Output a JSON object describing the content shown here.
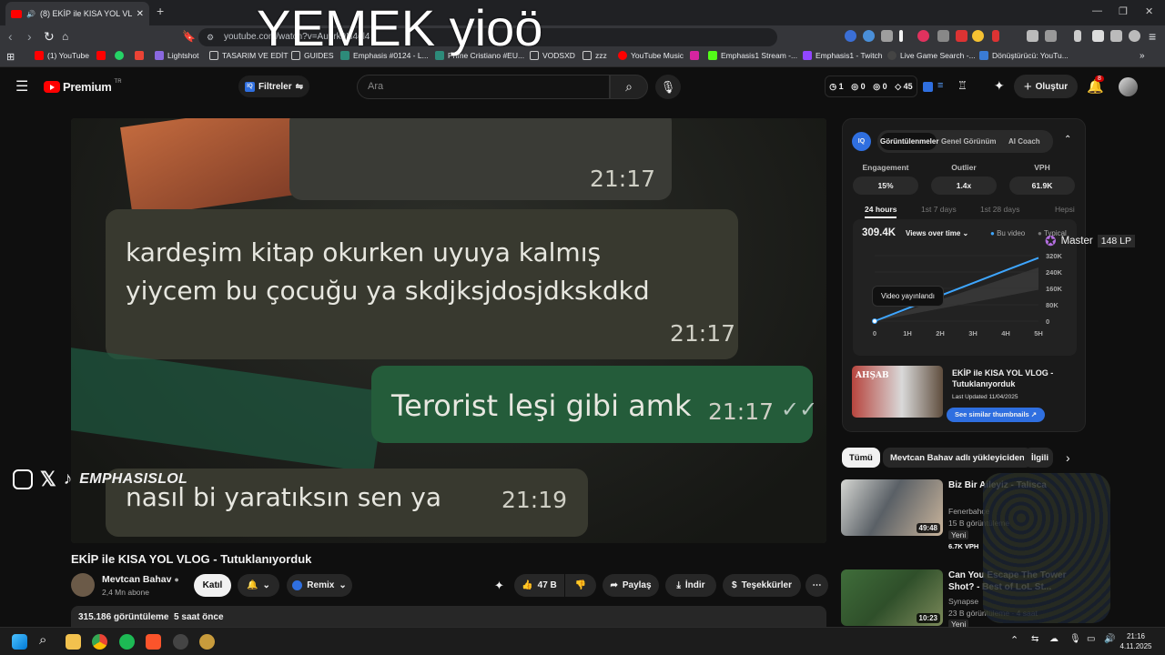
{
  "browser": {
    "tab_title": "(8) EKİP ile KISA YOL VLOG - T",
    "url": "youtube.com/watch?v=Au9rk0N4gl4",
    "bookmarks": [
      "(1) YouTube",
      "Lightshot",
      "TASARIM VE EDİT",
      "GUIDES",
      "Emphasis #0124 - L...",
      "Prime Cristiano #EU...",
      "VODSXD",
      "zzz",
      "YouTube Music",
      "Emphasis1 Stream -...",
      "Emphasis1 - Twitch",
      "Live Game Search -...",
      "Dönüştürücü: YouTu..."
    ]
  },
  "overlay": {
    "big_text": "YEMEK yioö"
  },
  "youtube": {
    "logo_text": "Premium",
    "logo_sup": "TR",
    "filter_label": "Filtreler",
    "search_placeholder": "Ara",
    "header_stats": [
      "1",
      "0",
      "0",
      "45"
    ],
    "create_label": "Oluştur",
    "notif_count": "8"
  },
  "video": {
    "messages": [
      {
        "text": "",
        "time": "21:17"
      },
      {
        "text_line1": "kardeşim kitap okurken uyuya kalmış",
        "text_line2": "yiycem bu çocuğu ya skdjksjdosjdkskdkd",
        "time": "21:17"
      },
      {
        "text": "Terorist leşi gibi amk",
        "time": "21:17"
      },
      {
        "text": "nasıl bi yaratıksın sen ya",
        "time": "21:19"
      }
    ],
    "watermark": "EMPHASISLOL"
  },
  "info": {
    "title": "EKİP ile KISA YOL VLOG - Tutuklanıyorduk",
    "channel": "Mevtcan Bahav",
    "subs": "2,4 Mn abone",
    "join": "Katıl",
    "remix": "Remix",
    "likes": "47 B",
    "share": "Paylaş",
    "download": "İndir",
    "thanks": "Teşekkürler",
    "views_line": "315.186 görüntüleme  5 saat önce"
  },
  "iq_panel": {
    "tabs": [
      "Görüntülenmeler",
      "Genel Görünüm",
      "AI Coach"
    ],
    "stat_labels": [
      "Engagement",
      "Outlier",
      "VPH"
    ],
    "stat_values": [
      "15%",
      "1.4x",
      "61.9K"
    ],
    "ranges": [
      "24 hours",
      "1st 7 days",
      "1st 28 days",
      "Hepsi"
    ],
    "views_total": "309.4K",
    "views_mode": "Views over time",
    "legend": [
      "Bu video",
      "Typical"
    ],
    "tooltip": "Video yayınlandı",
    "rank": "Master",
    "lp": "148 LP",
    "video_title": "EKİP ile KISA YOL VLOG - Tutuklanıyorduk",
    "updated": "Last Updated 11/04/2025",
    "similar_btn": "See similar thumbnails",
    "chart_data": {
      "type": "line",
      "x": [
        "0",
        "1H",
        "2H",
        "3H",
        "4H",
        "5H"
      ],
      "y_ticks": [
        "320K",
        "240K",
        "160K",
        "80K",
        "0"
      ],
      "ylim": [
        0,
        320000
      ],
      "series": [
        {
          "name": "Bu video",
          "values": [
            0,
            62000,
            124000,
            186000,
            248000,
            309400
          ]
        }
      ]
    }
  },
  "chips": [
    "Tümü",
    "Mevtcan Bahav adlı yükleyiciden",
    "İlgili"
  ],
  "recs": [
    {
      "title": "Biz Bir Aileyiz - Talisca",
      "channel": "Fenerbahçe",
      "meta": "15 B görüntüleme",
      "badge": "Yeni",
      "vph": "6.7K VPH",
      "duration": "49:48"
    },
    {
      "title": "Can You Escape The Tower Shot? - Best of LoL St...",
      "channel": "Synapse",
      "meta": "23 B görüntüleme · 4 saat",
      "badge": "Yeni",
      "duration": "10:23"
    }
  ],
  "taskbar": {
    "time": "21:16",
    "date": "4.11.2025"
  }
}
